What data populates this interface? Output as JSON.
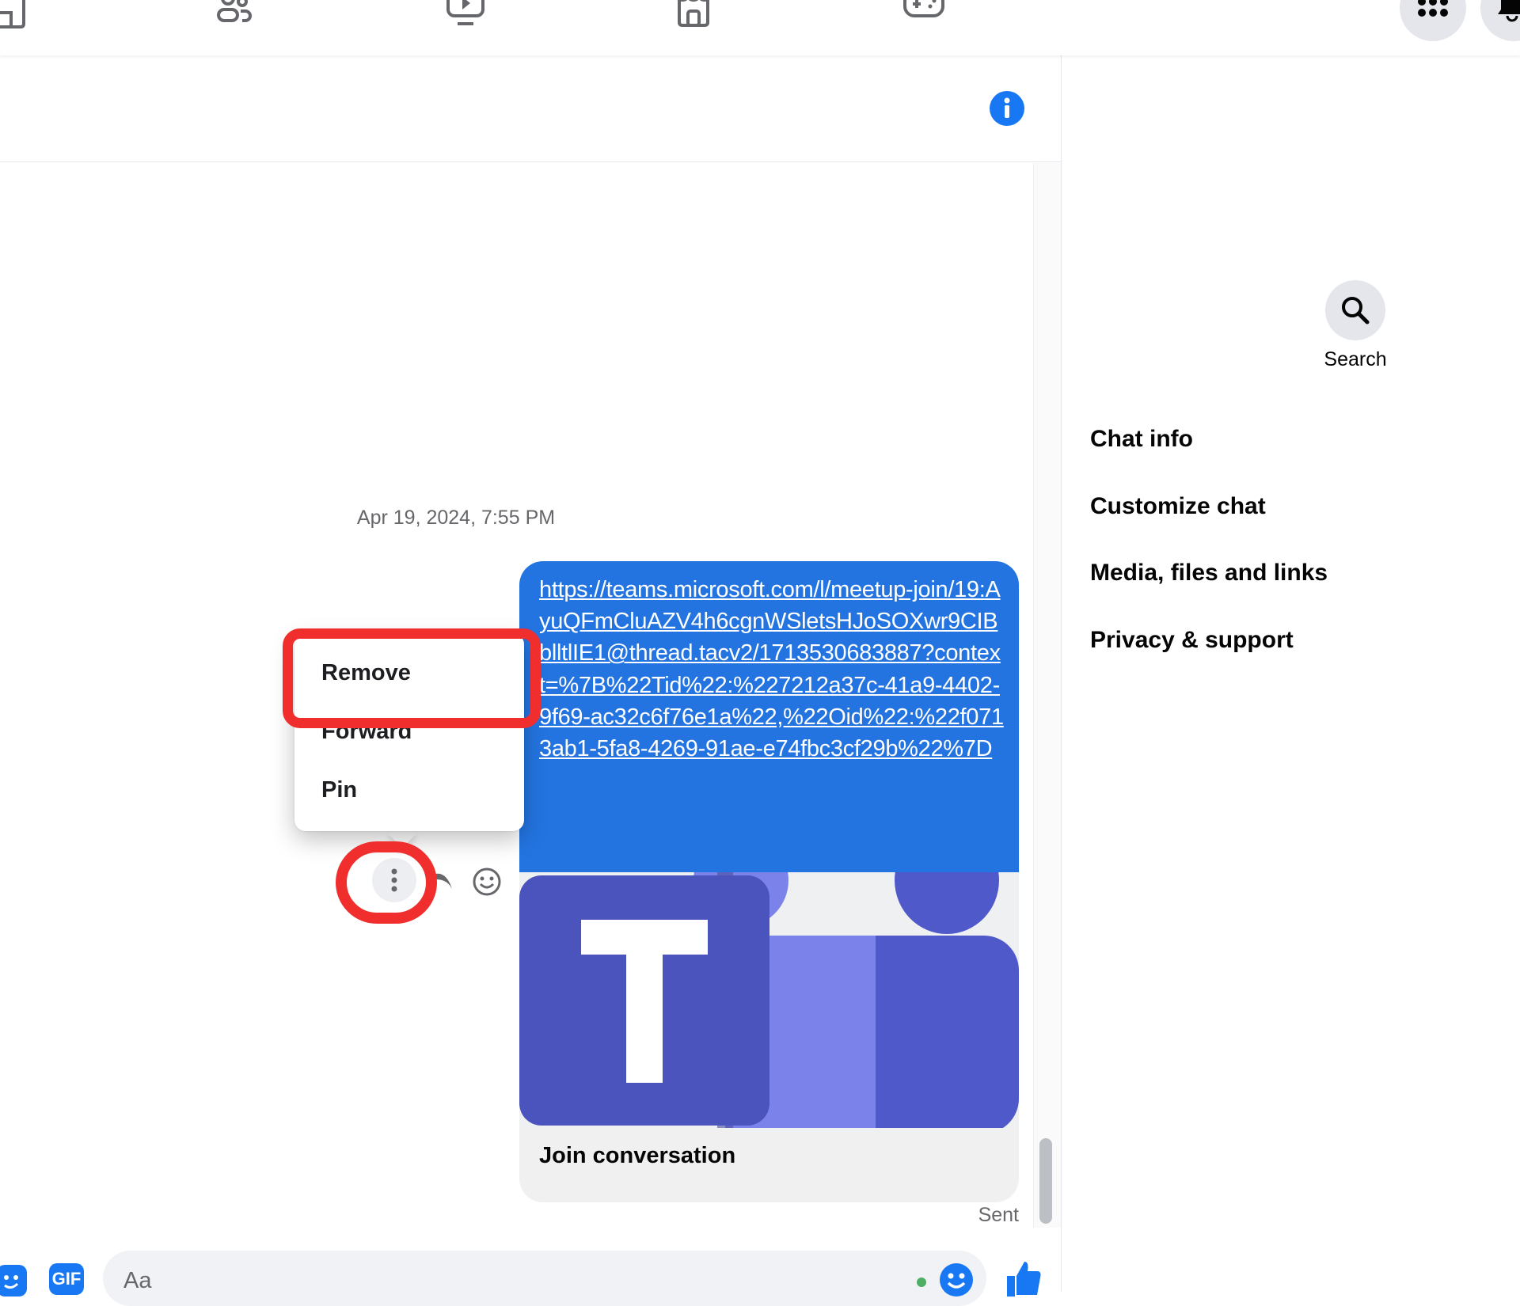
{
  "topnav": {
    "icons": [
      "home-icon",
      "friends-icon",
      "watch-icon",
      "marketplace-icon",
      "gaming-icon"
    ],
    "menu_icon": "grid-menu-icon",
    "notifications_icon": "bell-icon"
  },
  "chat_header": {
    "info_icon": "info-icon"
  },
  "conversation": {
    "timestamp": "Apr 19, 2024, 7:55 PM",
    "message": {
      "link_text": "https://teams.microsoft.com/l/meetup-join/19:AyuQFmCluAZV4h6cgnWSletsHJoSOXwr9CIBblltlIE1@thread.tacv2/1713530683887?context=%7B%22Tid%22:%227212a37c-41a9-4402-9f69-ac32c6f76e1a%22,%22Oid%22:%22f0713ab1-5fa8-4269-91ae-e74fbc3cf29b%22%7D",
      "preview_title": "Join conversation",
      "preview_image": "microsoft-teams-logo",
      "status": "Sent"
    },
    "hover_actions": [
      "more-icon",
      "reply-icon",
      "react-icon"
    ]
  },
  "context_menu": {
    "items": [
      {
        "label": "Remove",
        "highlighted": true
      },
      {
        "label": "Forward",
        "highlighted": false
      },
      {
        "label": "Pin",
        "highlighted": false
      }
    ]
  },
  "annotation_color": "#f02e2e",
  "right_panel": {
    "search_label": "Search",
    "items": [
      "Chat info",
      "Customize chat",
      "Media, files and links",
      "Privacy & support"
    ]
  },
  "composer": {
    "placeholder": "Aa",
    "gif_label": "GIF"
  },
  "colors": {
    "accent": "#1877f2",
    "bubble": "#2374e1",
    "teams_dark": "#4b53bc",
    "teams_light": "#7b83eb"
  }
}
